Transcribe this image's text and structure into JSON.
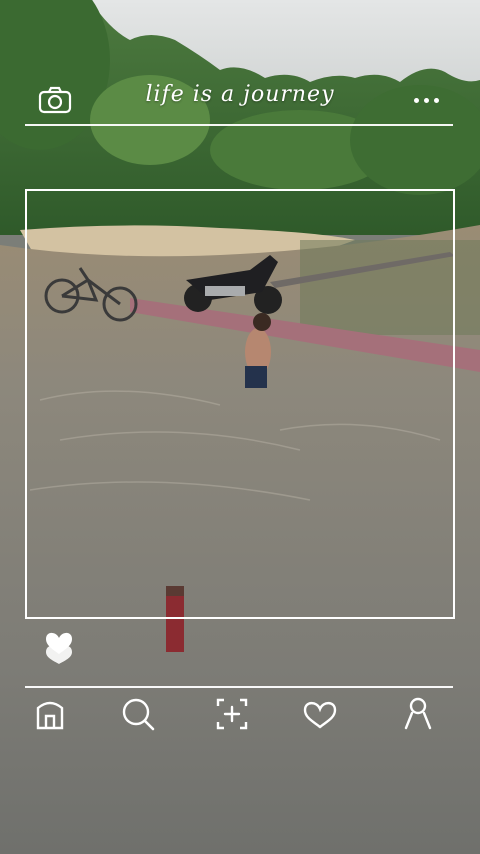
{
  "header": {
    "title": "life is a journey",
    "camera_icon": "camera-icon",
    "more_icon": "more-dots-icon"
  },
  "feed": {
    "like_icon": "heart-filled-icon"
  },
  "nav": {
    "items": [
      {
        "icon": "home-icon"
      },
      {
        "icon": "search-icon"
      },
      {
        "icon": "add-post-icon"
      },
      {
        "icon": "heart-outline-icon"
      },
      {
        "icon": "profile-icon"
      }
    ]
  },
  "colors": {
    "overlay": "#ffffff",
    "water": "#8c8a7e",
    "forest": "#3f6b34",
    "sky": "#d9dcdc"
  }
}
